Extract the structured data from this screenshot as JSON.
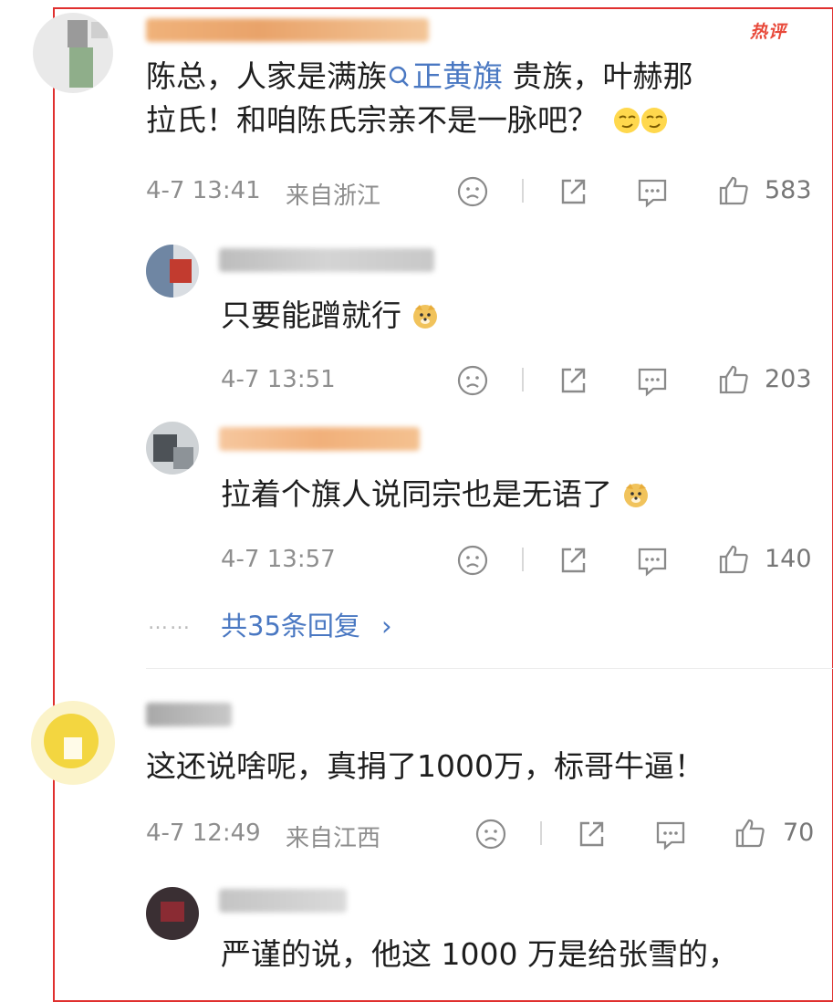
{
  "badge": {
    "hot": "热评"
  },
  "comments": [
    {
      "text_line1_a": "陈总，人家是满族",
      "topic": "正黄旗",
      "text_line1_b": " 贵族，叶赫那",
      "text_line2": "拉氏！和咱陈氏宗亲不是一脉吧？",
      "emojis": [
        "smirk-face-icon",
        "smirk-face-icon"
      ],
      "time": "4-7 13:41",
      "location": "来自浙江",
      "likes": "583"
    },
    {
      "text": "只要能蹭就行",
      "emoji": "doge-icon",
      "time": "4-7 13:51",
      "likes": "203"
    },
    {
      "text": "拉着个旗人说同宗也是无语了",
      "emoji": "doge-icon",
      "time": "4-7 13:57",
      "likes": "140"
    },
    {
      "text": "这还说啥呢，真捐了1000万，标哥牛逼！",
      "time": "4-7 12:49",
      "location": "来自江西",
      "likes": "70"
    },
    {
      "text": "严谨的说，他这 1000 万是给张雪的，"
    }
  ],
  "reply_summary": {
    "dots": "……",
    "label": "共35条回复",
    "chevron": "›"
  },
  "colors": {
    "accent_blue": "#4a78c2",
    "hot_red": "#e8493a",
    "frame_red": "#e0302f"
  }
}
